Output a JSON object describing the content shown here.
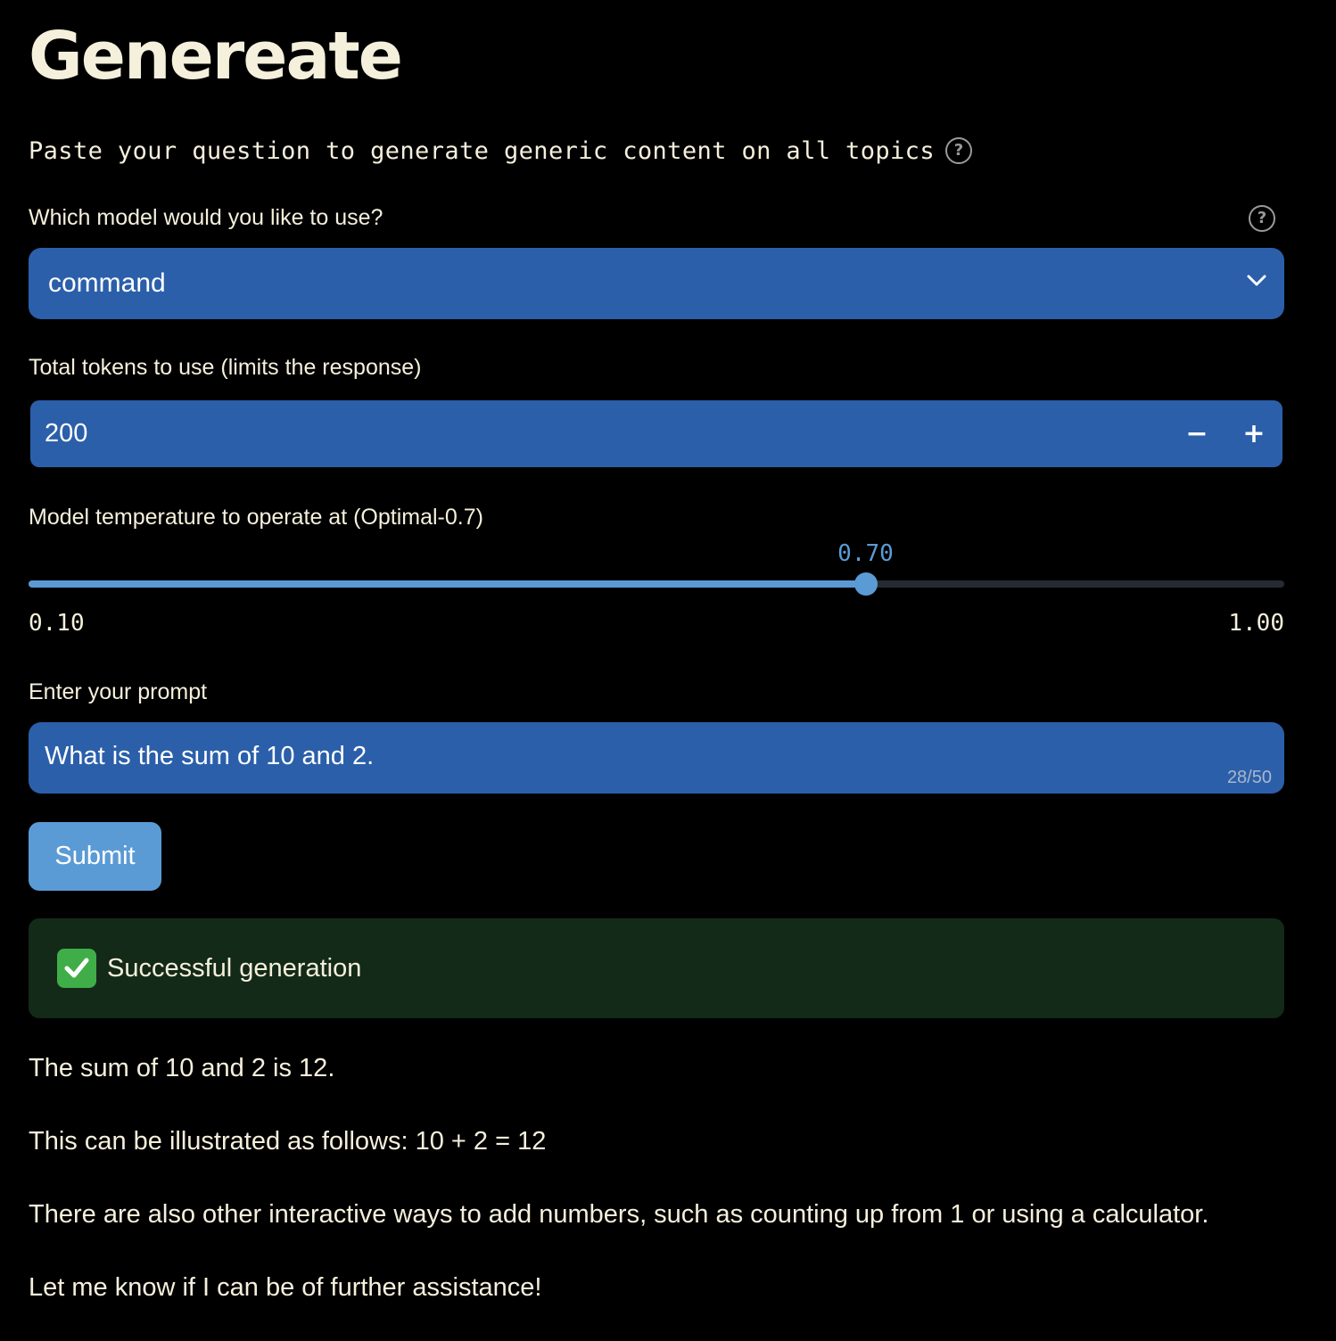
{
  "page": {
    "title": "Genereate",
    "subtitle": "Paste your question to generate generic content on all topics"
  },
  "model_select": {
    "label": "Which model would you like to use?",
    "value": "command"
  },
  "tokens_input": {
    "label": "Total tokens to use (limits the response)",
    "value": "200",
    "decrement_symbol": "−",
    "increment_symbol": "+"
  },
  "temperature_slider": {
    "label": "Model temperature to operate at (Optimal-0.7)",
    "value": 0.7,
    "value_display": "0.70",
    "min": 0.1,
    "max": 1.0,
    "min_display": "0.10",
    "max_display": "1.00"
  },
  "prompt_input": {
    "label": "Enter your prompt",
    "value": "What is the sum of 10 and 2.",
    "char_count": "28/50"
  },
  "submit_button": {
    "label": "Submit"
  },
  "status": {
    "message": "Successful generation",
    "icon": "check-mark-icon"
  },
  "response": {
    "paragraphs": [
      "The sum of 10 and 2 is 12.",
      "This can be illustrated as follows: 10 + 2 = 12",
      "There are also other interactive ways to add numbers, such as counting up from 1 or using a calculator.",
      "Let me know if I can be of further assistance!"
    ]
  },
  "colors": {
    "background": "#000000",
    "text": "#f5f0dc",
    "input_bg": "#2b5faa",
    "accent": "#5b9bd5",
    "success_bg": "#142a19",
    "success_icon": "#3fae49"
  }
}
